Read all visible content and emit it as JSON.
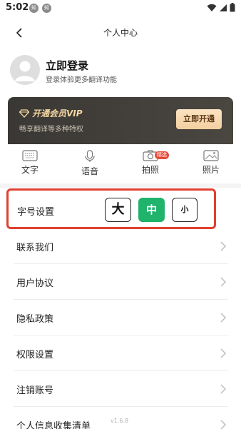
{
  "status_bar": {
    "time": "5:02",
    "badges": [
      "知",
      "知"
    ]
  },
  "nav": {
    "title": "个人中心"
  },
  "profile": {
    "title": "立即登录",
    "subtitle": "登录体验更多翻译功能"
  },
  "vip": {
    "title": "开通会员VIP",
    "subtitle": "畅享翻译等多种特权",
    "button": "立即开通"
  },
  "modes": [
    {
      "label": "文字",
      "icon": "keyboard-icon"
    },
    {
      "label": "语音",
      "icon": "microphone-icon"
    },
    {
      "label": "拍照",
      "icon": "camera-icon",
      "badge": "精选"
    },
    {
      "label": "照片",
      "icon": "image-icon"
    }
  ],
  "font_setting": {
    "label": "字号设置",
    "options": [
      "大",
      "中",
      "小"
    ],
    "selected": "中"
  },
  "menu": [
    {
      "label": "联系我们"
    },
    {
      "label": "用户协议"
    },
    {
      "label": "隐私政策"
    },
    {
      "label": "权限设置"
    },
    {
      "label": "注销账号"
    },
    {
      "label": "个人信息收集清单"
    }
  ],
  "version": "v1.6.8",
  "colors": {
    "accent_green": "#1fb36b",
    "highlight_red": "#e0402f",
    "vip_gold": "#f6d9a4"
  }
}
